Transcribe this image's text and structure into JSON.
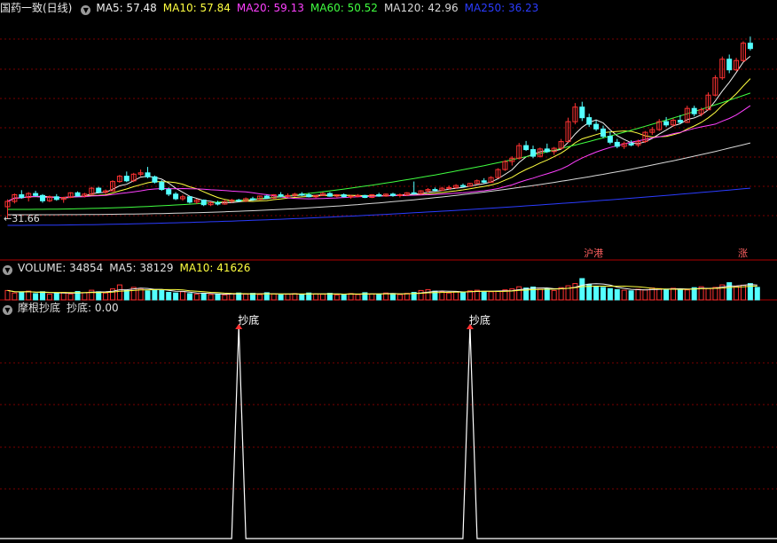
{
  "price_panel": {
    "title": "国药一致(日线)",
    "ma_labels": [
      {
        "text": "MA5: 57.48",
        "color": "#f0f0f0"
      },
      {
        "text": "MA10: 57.84",
        "color": "#ffff40"
      },
      {
        "text": "MA20: 59.13",
        "color": "#ff40ff"
      },
      {
        "text": "MA60: 50.52",
        "color": "#40ff40"
      },
      {
        "text": "MA120: 42.96",
        "color": "#d8d8d8"
      },
      {
        "text": "MA250: 36.23",
        "color": "#2b3cff"
      }
    ],
    "low_marker": "31.66",
    "event_tags": [
      {
        "text": "沪港",
        "color": "#ff6060"
      },
      {
        "text": "涨",
        "color": "#ff6060"
      }
    ]
  },
  "volume_panel": {
    "labels": [
      {
        "text": "VOLUME: 34854",
        "color": "#e0e0e0"
      },
      {
        "text": "MA5: 38129",
        "color": "#e0e0e0"
      },
      {
        "text": "MA10: 41626",
        "color": "#ffff40"
      }
    ]
  },
  "indicator_panel": {
    "labels": [
      {
        "text": "摩根抄底",
        "color": "#e0e0e0"
      },
      {
        "text": "抄底: 0.00",
        "color": "#e0e0e0"
      }
    ],
    "signal_label": "抄底"
  },
  "colors": {
    "up": "#ff3232",
    "down": "#54ffff",
    "grid": "#7a0000",
    "separator": "#b00000",
    "background": "#000000"
  },
  "chart_data": [
    {
      "type": "candlestick",
      "title": "国药一致(日线)",
      "candles": [
        {
          "o": 33.4,
          "h": 34.5,
          "l": 31.66,
          "c": 34.2
        },
        {
          "o": 34.2,
          "h": 35.4,
          "l": 33.9,
          "c": 35.2
        },
        {
          "o": 35.2,
          "h": 35.9,
          "l": 34.6,
          "c": 34.8
        },
        {
          "o": 34.8,
          "h": 35.6,
          "l": 34.2,
          "c": 35.4
        },
        {
          "o": 35.4,
          "h": 35.8,
          "l": 34.9,
          "c": 35.1
        },
        {
          "o": 35.1,
          "h": 35.3,
          "l": 34.0,
          "c": 34.3
        },
        {
          "o": 34.3,
          "h": 35.1,
          "l": 34.1,
          "c": 34.9
        },
        {
          "o": 34.9,
          "h": 35.3,
          "l": 34.3,
          "c": 34.5
        },
        {
          "o": 34.5,
          "h": 34.9,
          "l": 34.0,
          "c": 34.8
        },
        {
          "o": 34.8,
          "h": 35.6,
          "l": 34.7,
          "c": 35.5
        },
        {
          "o": 35.5,
          "h": 35.7,
          "l": 34.9,
          "c": 35.0
        },
        {
          "o": 35.0,
          "h": 35.5,
          "l": 34.8,
          "c": 35.3
        },
        {
          "o": 35.3,
          "h": 36.4,
          "l": 35.2,
          "c": 36.2
        },
        {
          "o": 36.2,
          "h": 36.4,
          "l": 35.4,
          "c": 35.6
        },
        {
          "o": 35.6,
          "h": 36.0,
          "l": 35.3,
          "c": 35.8
        },
        {
          "o": 35.8,
          "h": 37.4,
          "l": 35.7,
          "c": 37.2
        },
        {
          "o": 37.2,
          "h": 38.2,
          "l": 37.0,
          "c": 38.0
        },
        {
          "o": 38.0,
          "h": 38.7,
          "l": 37.1,
          "c": 37.3
        },
        {
          "o": 37.3,
          "h": 38.5,
          "l": 37.1,
          "c": 38.3
        },
        {
          "o": 38.3,
          "h": 39.0,
          "l": 38.0,
          "c": 38.5
        },
        {
          "o": 38.5,
          "h": 39.4,
          "l": 37.7,
          "c": 37.9
        },
        {
          "o": 37.9,
          "h": 38.1,
          "l": 36.9,
          "c": 37.1
        },
        {
          "o": 37.1,
          "h": 37.4,
          "l": 35.8,
          "c": 36.0
        },
        {
          "o": 36.0,
          "h": 36.3,
          "l": 35.0,
          "c": 35.3
        },
        {
          "o": 35.3,
          "h": 35.6,
          "l": 34.4,
          "c": 34.6
        },
        {
          "o": 34.6,
          "h": 35.2,
          "l": 34.3,
          "c": 34.9
        },
        {
          "o": 34.9,
          "h": 35.0,
          "l": 33.9,
          "c": 34.1
        },
        {
          "o": 34.1,
          "h": 34.6,
          "l": 33.8,
          "c": 34.4
        },
        {
          "o": 34.4,
          "h": 34.5,
          "l": 33.5,
          "c": 33.7
        },
        {
          "o": 33.7,
          "h": 34.2,
          "l": 33.5,
          "c": 34.0
        },
        {
          "o": 34.0,
          "h": 34.3,
          "l": 33.6,
          "c": 33.8
        },
        {
          "o": 33.8,
          "h": 34.4,
          "l": 33.7,
          "c": 34.2
        },
        {
          "o": 34.2,
          "h": 34.6,
          "l": 34.0,
          "c": 34.4
        },
        {
          "o": 34.4,
          "h": 34.6,
          "l": 34.1,
          "c": 34.3
        },
        {
          "o": 34.3,
          "h": 34.8,
          "l": 34.1,
          "c": 34.6
        },
        {
          "o": 34.6,
          "h": 34.9,
          "l": 34.3,
          "c": 34.5
        },
        {
          "o": 34.5,
          "h": 35.1,
          "l": 34.4,
          "c": 35.0
        },
        {
          "o": 35.0,
          "h": 35.2,
          "l": 34.6,
          "c": 34.7
        },
        {
          "o": 34.7,
          "h": 35.3,
          "l": 34.6,
          "c": 35.2
        },
        {
          "o": 35.2,
          "h": 35.6,
          "l": 34.8,
          "c": 35.0
        },
        {
          "o": 35.0,
          "h": 35.4,
          "l": 34.8,
          "c": 35.1
        },
        {
          "o": 35.1,
          "h": 35.5,
          "l": 34.9,
          "c": 35.3
        },
        {
          "o": 35.3,
          "h": 35.6,
          "l": 35.0,
          "c": 35.2
        },
        {
          "o": 35.2,
          "h": 35.5,
          "l": 34.8,
          "c": 34.9
        },
        {
          "o": 34.9,
          "h": 35.2,
          "l": 34.7,
          "c": 35.1
        },
        {
          "o": 35.1,
          "h": 35.6,
          "l": 35.0,
          "c": 35.4
        },
        {
          "o": 35.4,
          "h": 35.6,
          "l": 34.9,
          "c": 35.0
        },
        {
          "o": 35.0,
          "h": 35.3,
          "l": 34.8,
          "c": 35.2
        },
        {
          "o": 35.2,
          "h": 35.4,
          "l": 34.8,
          "c": 34.9
        },
        {
          "o": 34.9,
          "h": 35.2,
          "l": 34.6,
          "c": 35.0
        },
        {
          "o": 35.0,
          "h": 35.3,
          "l": 34.8,
          "c": 35.1
        },
        {
          "o": 35.1,
          "h": 35.2,
          "l": 34.7,
          "c": 34.8
        },
        {
          "o": 34.8,
          "h": 35.3,
          "l": 34.7,
          "c": 35.2
        },
        {
          "o": 35.2,
          "h": 35.5,
          "l": 34.9,
          "c": 35.0
        },
        {
          "o": 35.0,
          "h": 35.4,
          "l": 34.9,
          "c": 35.3
        },
        {
          "o": 35.3,
          "h": 35.5,
          "l": 34.9,
          "c": 35.1
        },
        {
          "o": 35.1,
          "h": 35.4,
          "l": 34.8,
          "c": 35.2
        },
        {
          "o": 35.2,
          "h": 35.6,
          "l": 35.0,
          "c": 35.5
        },
        {
          "o": 35.5,
          "h": 37.2,
          "l": 35.2,
          "c": 35.4
        },
        {
          "o": 35.4,
          "h": 35.9,
          "l": 35.2,
          "c": 35.8
        },
        {
          "o": 35.8,
          "h": 36.2,
          "l": 35.5,
          "c": 36.0
        },
        {
          "o": 36.0,
          "h": 36.3,
          "l": 35.7,
          "c": 35.9
        },
        {
          "o": 35.9,
          "h": 36.4,
          "l": 35.8,
          "c": 36.2
        },
        {
          "o": 36.2,
          "h": 36.6,
          "l": 36.0,
          "c": 36.3
        },
        {
          "o": 36.3,
          "h": 36.8,
          "l": 36.1,
          "c": 36.6
        },
        {
          "o": 36.6,
          "h": 36.9,
          "l": 36.3,
          "c": 36.5
        },
        {
          "o": 36.5,
          "h": 37.0,
          "l": 36.4,
          "c": 36.9
        },
        {
          "o": 36.9,
          "h": 37.5,
          "l": 36.8,
          "c": 37.3
        },
        {
          "o": 37.3,
          "h": 37.7,
          "l": 36.9,
          "c": 37.1
        },
        {
          "o": 37.1,
          "h": 38.0,
          "l": 37.0,
          "c": 37.8
        },
        {
          "o": 37.8,
          "h": 39.2,
          "l": 37.7,
          "c": 39.0
        },
        {
          "o": 39.0,
          "h": 40.4,
          "l": 38.8,
          "c": 40.2
        },
        {
          "o": 40.2,
          "h": 41.0,
          "l": 39.6,
          "c": 40.7
        },
        {
          "o": 40.7,
          "h": 43.0,
          "l": 40.5,
          "c": 42.6
        },
        {
          "o": 42.6,
          "h": 43.3,
          "l": 41.8,
          "c": 42.0
        },
        {
          "o": 42.0,
          "h": 42.6,
          "l": 40.7,
          "c": 41.0
        },
        {
          "o": 41.0,
          "h": 42.3,
          "l": 40.8,
          "c": 42.1
        },
        {
          "o": 42.1,
          "h": 42.9,
          "l": 41.5,
          "c": 41.7
        },
        {
          "o": 41.7,
          "h": 42.4,
          "l": 41.2,
          "c": 42.2
        },
        {
          "o": 42.2,
          "h": 43.6,
          "l": 42.0,
          "c": 43.2
        },
        {
          "o": 43.2,
          "h": 46.8,
          "l": 43.1,
          "c": 46.2
        },
        {
          "o": 46.2,
          "h": 49.0,
          "l": 45.8,
          "c": 48.4
        },
        {
          "o": 48.4,
          "h": 49.2,
          "l": 46.3,
          "c": 46.8
        },
        {
          "o": 46.8,
          "h": 47.4,
          "l": 45.4,
          "c": 45.8
        },
        {
          "o": 45.8,
          "h": 46.4,
          "l": 44.8,
          "c": 45.1
        },
        {
          "o": 45.1,
          "h": 45.6,
          "l": 43.7,
          "c": 44.0
        },
        {
          "o": 44.0,
          "h": 44.7,
          "l": 42.8,
          "c": 43.1
        },
        {
          "o": 43.1,
          "h": 43.6,
          "l": 42.2,
          "c": 42.5
        },
        {
          "o": 42.5,
          "h": 43.2,
          "l": 42.1,
          "c": 42.9
        },
        {
          "o": 42.9,
          "h": 43.4,
          "l": 42.5,
          "c": 42.7
        },
        {
          "o": 42.7,
          "h": 43.5,
          "l": 42.4,
          "c": 43.2
        },
        {
          "o": 43.2,
          "h": 44.8,
          "l": 43.0,
          "c": 44.6
        },
        {
          "o": 44.6,
          "h": 45.4,
          "l": 44.2,
          "c": 45.0
        },
        {
          "o": 45.0,
          "h": 46.6,
          "l": 44.8,
          "c": 46.2
        },
        {
          "o": 46.2,
          "h": 46.9,
          "l": 45.4,
          "c": 45.7
        },
        {
          "o": 45.7,
          "h": 46.7,
          "l": 45.4,
          "c": 46.4
        },
        {
          "o": 46.4,
          "h": 47.2,
          "l": 45.9,
          "c": 46.1
        },
        {
          "o": 46.1,
          "h": 48.6,
          "l": 46.0,
          "c": 48.2
        },
        {
          "o": 48.2,
          "h": 48.6,
          "l": 47.0,
          "c": 47.4
        },
        {
          "o": 47.4,
          "h": 48.3,
          "l": 47.0,
          "c": 48.0
        },
        {
          "o": 48.0,
          "h": 50.6,
          "l": 47.9,
          "c": 50.2
        },
        {
          "o": 50.2,
          "h": 53.2,
          "l": 50.0,
          "c": 52.8
        },
        {
          "o": 52.8,
          "h": 56.0,
          "l": 52.5,
          "c": 55.6
        },
        {
          "o": 55.6,
          "h": 56.3,
          "l": 53.5,
          "c": 54.0
        },
        {
          "o": 54.0,
          "h": 55.8,
          "l": 53.8,
          "c": 55.4
        },
        {
          "o": 55.4,
          "h": 58.3,
          "l": 55.2,
          "c": 58.0
        },
        {
          "o": 58.0,
          "h": 59.0,
          "l": 56.9,
          "c": 57.2
        }
      ],
      "moving_averages": [
        "MA5",
        "MA10",
        "MA20",
        "MA60",
        "MA120",
        "MA250"
      ],
      "low_label": 31.66
    },
    {
      "type": "bar",
      "title": "VOLUME",
      "volumes": [
        30,
        22,
        25,
        28,
        20,
        26,
        18,
        21,
        24,
        19,
        27,
        23,
        31,
        26,
        22,
        35,
        48,
        30,
        40,
        36,
        29,
        33,
        31,
        24,
        22,
        26,
        20,
        18,
        21,
        17,
        19,
        16,
        20,
        22,
        18,
        21,
        17,
        23,
        19,
        16,
        18,
        20,
        17,
        22,
        19,
        18,
        21,
        16,
        18,
        20,
        17,
        23,
        19,
        18,
        22,
        20,
        17,
        21,
        24,
        30,
        33,
        28,
        26,
        22,
        27,
        25,
        29,
        31,
        27,
        26,
        28,
        32,
        35,
        42,
        38,
        41,
        34,
        36,
        30,
        39,
        45,
        52,
        68,
        50,
        44,
        40,
        36,
        33,
        31,
        29,
        34,
        32,
        38,
        36,
        33,
        37,
        35,
        32,
        39,
        42,
        36,
        40,
        48,
        55,
        44,
        47,
        52,
        40
      ],
      "volume_ma5": 38129,
      "volume_ma10": 41626,
      "last_volume": 34854
    },
    {
      "type": "line",
      "title": "摩根抄底",
      "series": [
        {
          "name": "抄底",
          "signal_bars": [
            33,
            66
          ],
          "last_value": 0.0
        }
      ]
    }
  ]
}
